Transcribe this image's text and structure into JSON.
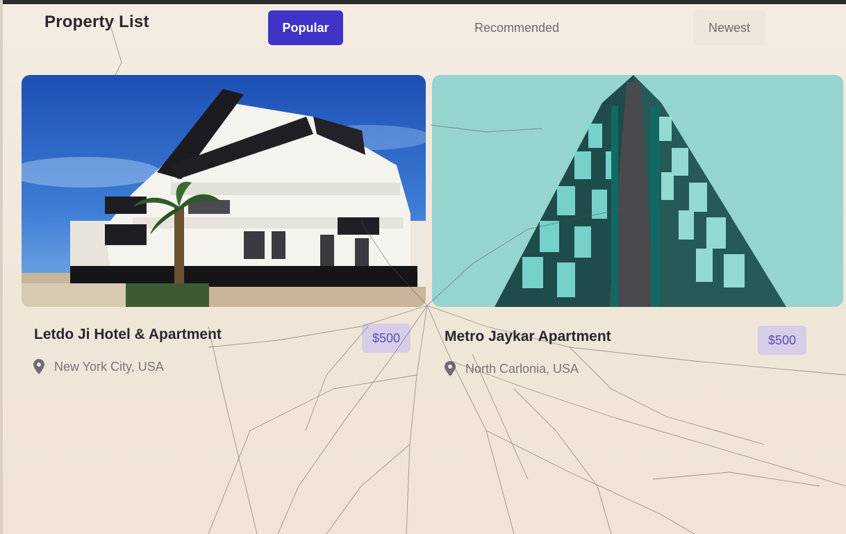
{
  "header": {
    "title": "Property List"
  },
  "tabs": [
    {
      "label": "Popular",
      "active": true
    },
    {
      "label": "Recommended",
      "active": false
    },
    {
      "label": "Newest",
      "active": false
    }
  ],
  "properties": [
    {
      "title": "Letdo Ji Hotel & Apartment",
      "price": "$500",
      "location": "New York City, USA",
      "icon": "location-pin-icon"
    },
    {
      "title": "Metro Jaykar Apartment",
      "price": "$500",
      "location": "North Carlonia, USA",
      "icon": "location-pin-icon"
    }
  ],
  "colors": {
    "accent": "#3f34c6",
    "price_badge_bg": "#d7cde9",
    "price_text": "#5a4fb8",
    "background": "#f1e8dc"
  }
}
